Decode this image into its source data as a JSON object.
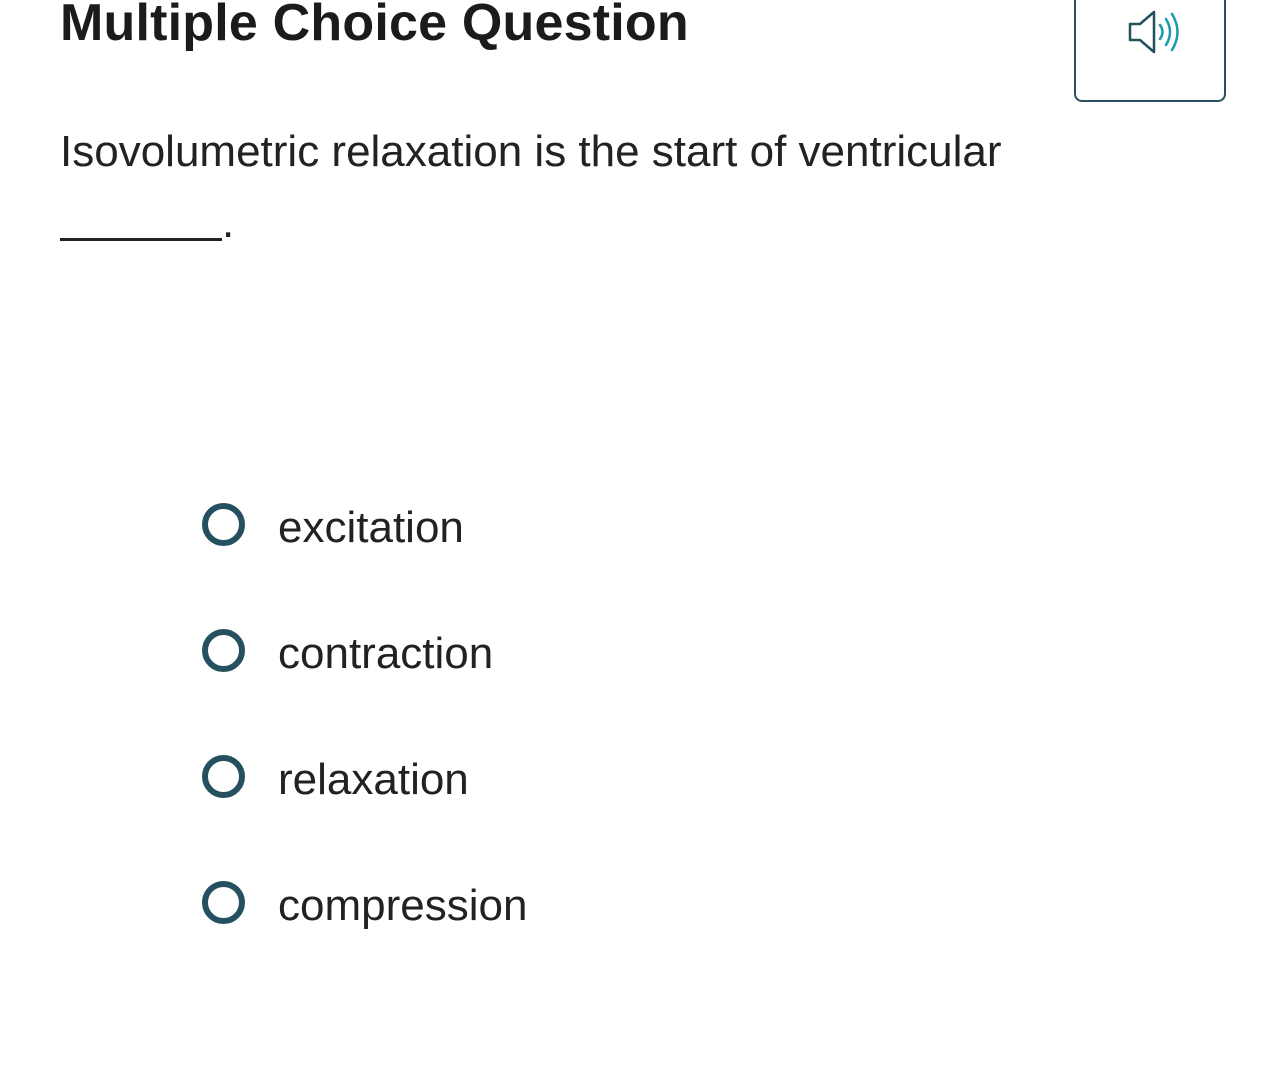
{
  "header": {
    "title": "Multiple Choice Question",
    "audio_icon": "speaker-icon",
    "audio_color": "#1b9ab0"
  },
  "question": {
    "text": "Isovolumetric relaxation is the start of ventricular",
    "blank_suffix": "."
  },
  "options": [
    {
      "label": "excitation",
      "selected": false
    },
    {
      "label": "contraction",
      "selected": false
    },
    {
      "label": "relaxation",
      "selected": false
    },
    {
      "label": "compression",
      "selected": false
    }
  ],
  "colors": {
    "accent_dark": "#25505f",
    "text": "#222222"
  }
}
